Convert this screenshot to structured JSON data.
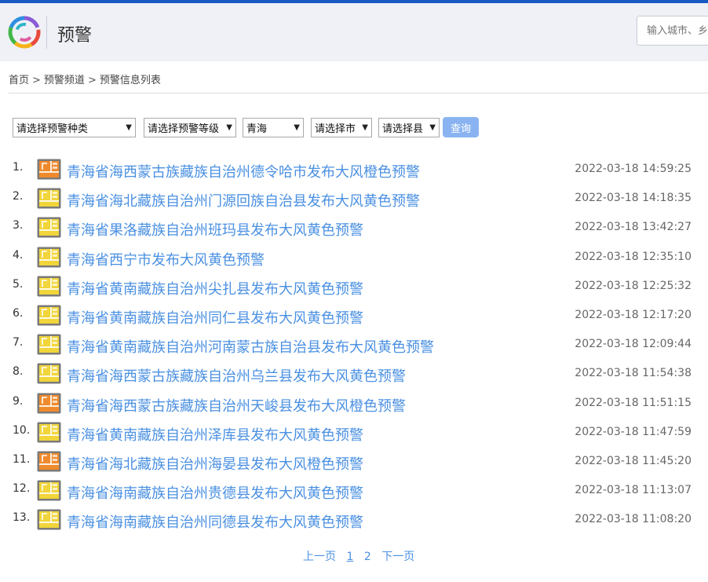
{
  "header": {
    "title": "预警",
    "search_placeholder": "输入城市、乡镇"
  },
  "breadcrumb": [
    "首页",
    "预警频道",
    "预警信息列表"
  ],
  "breadcrumb_sep": ">",
  "filters": {
    "type": "请选择预警种类",
    "level": "请选择预警等级",
    "province": "青海",
    "city": "请选择市",
    "county": "请选择县",
    "query_label": "查询"
  },
  "icon_colors": {
    "yellow": "#f1d53a",
    "orange": "#ef8a2c"
  },
  "warnings": [
    {
      "num": "1.",
      "title": "青海省海西蒙古族藏族自治州德令哈市发布大风橙色预警",
      "time": "2022-03-18 14:59:25",
      "level": "orange"
    },
    {
      "num": "2.",
      "title": "青海省海北藏族自治州门源回族自治县发布大风黄色预警",
      "time": "2022-03-18 14:18:35",
      "level": "yellow"
    },
    {
      "num": "3.",
      "title": "青海省果洛藏族自治州班玛县发布大风黄色预警",
      "time": "2022-03-18 13:42:27",
      "level": "yellow"
    },
    {
      "num": "4.",
      "title": "青海省西宁市发布大风黄色预警",
      "time": "2022-03-18 12:35:10",
      "level": "yellow"
    },
    {
      "num": "5.",
      "title": "青海省黄南藏族自治州尖扎县发布大风黄色预警",
      "time": "2022-03-18 12:25:32",
      "level": "yellow"
    },
    {
      "num": "6.",
      "title": "青海省黄南藏族自治州同仁县发布大风黄色预警",
      "time": "2022-03-18 12:17:20",
      "level": "yellow"
    },
    {
      "num": "7.",
      "title": "青海省黄南藏族自治州河南蒙古族自治县发布大风黄色预警",
      "time": "2022-03-18 12:09:44",
      "level": "yellow"
    },
    {
      "num": "8.",
      "title": "青海省海西蒙古族藏族自治州乌兰县发布大风黄色预警",
      "time": "2022-03-18 11:54:38",
      "level": "yellow"
    },
    {
      "num": "9.",
      "title": "青海省海西蒙古族藏族自治州天峻县发布大风橙色预警",
      "time": "2022-03-18 11:51:15",
      "level": "orange"
    },
    {
      "num": "10.",
      "title": "青海省黄南藏族自治州泽库县发布大风黄色预警",
      "time": "2022-03-18 11:47:59",
      "level": "yellow"
    },
    {
      "num": "11.",
      "title": "青海省海北藏族自治州海晏县发布大风橙色预警",
      "time": "2022-03-18 11:45:20",
      "level": "orange"
    },
    {
      "num": "12.",
      "title": "青海省海南藏族自治州贵德县发布大风黄色预警",
      "time": "2022-03-18 11:13:07",
      "level": "yellow"
    },
    {
      "num": "13.",
      "title": "青海省海南藏族自治州同德县发布大风黄色预警",
      "time": "2022-03-18 11:08:20",
      "level": "yellow"
    }
  ],
  "pager": {
    "prev": "上一页",
    "pages": [
      "1",
      "2"
    ],
    "current": "1",
    "next": "下一页"
  }
}
